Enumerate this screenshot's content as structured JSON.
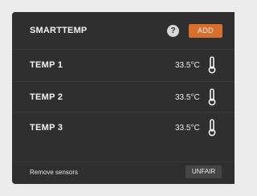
{
  "panel": {
    "title": "SMARTTEMP",
    "help_label": "?",
    "add_label": "ADD"
  },
  "sensors": [
    {
      "label": "TEMP 1",
      "value": "33.5°C",
      "icon": "thermometer-icon"
    },
    {
      "label": "TEMP 2",
      "value": "33.5°C",
      "icon": "thermometer-icon"
    },
    {
      "label": "TEMP 3",
      "value": "33.5°C",
      "icon": "thermometer-icon"
    }
  ],
  "footer": {
    "remove_label": "Remove sensors",
    "unfair_label": "UNFAIR"
  },
  "colors": {
    "panel_bg": "#2f2f2f",
    "accent": "#d86f2d",
    "page_bg": "#ececec"
  }
}
